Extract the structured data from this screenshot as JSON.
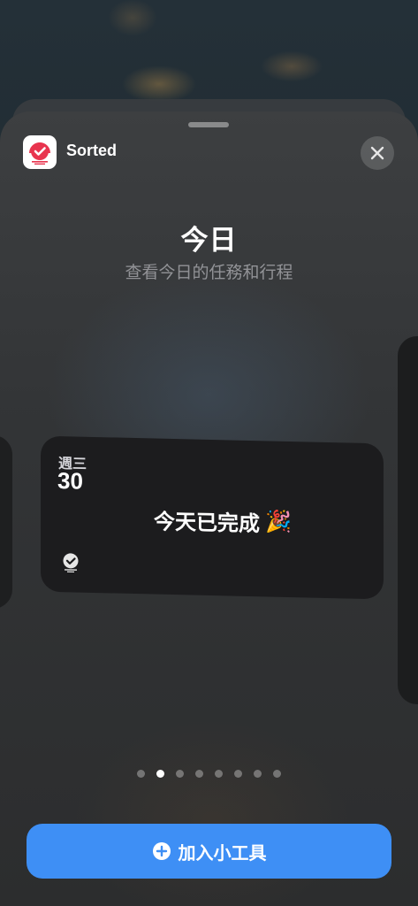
{
  "app": {
    "name": "Sorted",
    "icon": "sorted-app-icon"
  },
  "header": {
    "close_icon": "close-icon"
  },
  "widget_info": {
    "title": "今日",
    "subtitle": "查看今日的任務和行程"
  },
  "widget": {
    "weekday": "週三",
    "date": "30",
    "message": "今天已完成",
    "emoji": "🎉",
    "logo_icon": "sorted-logo-icon"
  },
  "pagination": {
    "count": 8,
    "active_index": 1
  },
  "add_button": {
    "label": "加入小工具",
    "icon": "plus-circle-icon"
  },
  "colors": {
    "accent": "#3e8ff5",
    "brand": "#e8344e",
    "widget_bg": "#1c1c1e"
  }
}
